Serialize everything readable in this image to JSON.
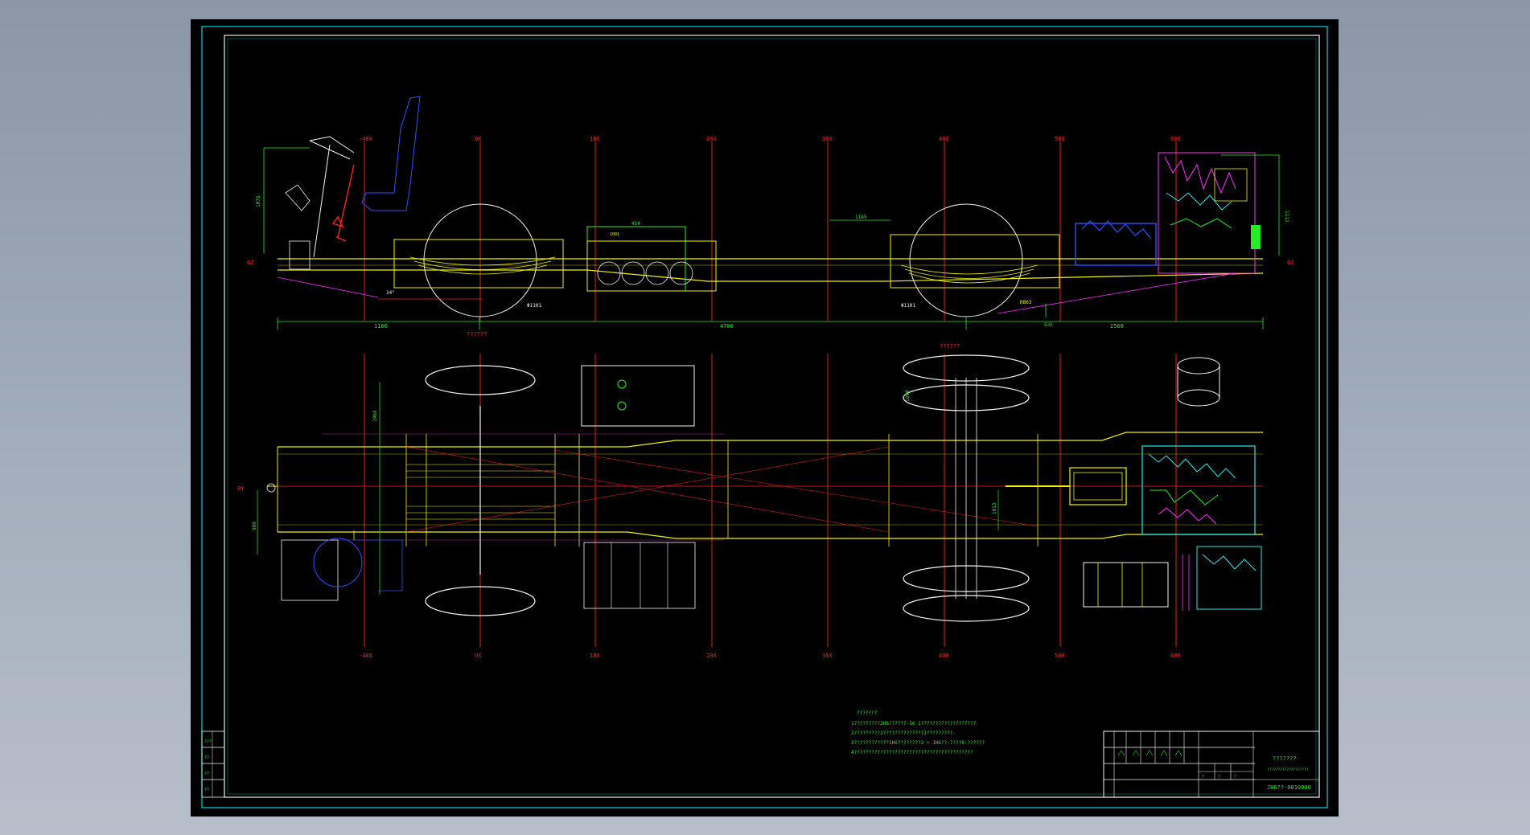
{
  "drawing": {
    "top_station_labels": [
      "-40X",
      "0X",
      "10X",
      "20X",
      "30X",
      "40X",
      "50X",
      "60X"
    ],
    "bottom_station_labels": [
      "-40X",
      "0X",
      "10X",
      "20X",
      "30X",
      "40X",
      "50X",
      "60X"
    ],
    "side_view": {
      "left_datum": "0Z",
      "right_datum": "0Z",
      "dim_overall": "??????",
      "dim_front": "1160",
      "dim_wheelbase": "4700",
      "dim_rear": "2560",
      "dim_small": "535",
      "dim_seat_height": "1075",
      "dim_engine_height": "1112",
      "dim_tank": "414",
      "dim_tank_inner": "1001",
      "dim_offset": "1185",
      "dim_angle": "14°",
      "dim_tire_front": "Φ1101",
      "dim_tire_rear": "Φ1101",
      "dim_radius": "R863"
    },
    "plan_view": {
      "left_datum": "0Y",
      "center_label": "??????",
      "dim_track": "980",
      "dim_width": "1013",
      "dim_front_track": "1968",
      "dim_rear_track": "1800"
    },
    "notes": {
      "heading": "???????",
      "lines": [
        "1?????????JH6??????-16  1???????????????????",
        "2?????????2??????????????2?????????-",
        "3????????????JH6????????2 + JH6??-????0-??????",
        "4?????????????????????????????????????????"
      ]
    },
    "title_block": {
      "project_title": "???????",
      "subtitle": "???????????????????",
      "drawing_number": "JH6??-0010000",
      "weight_label": "?",
      "scale_label": "?",
      "sheet_label": "?"
    },
    "revision_block": {
      "labels": [
        "???",
        "??",
        "??",
        "??"
      ]
    }
  },
  "colors": {
    "background": "#000000",
    "frame": "#00d7d7",
    "yellow": "#f2f200",
    "red": "#ff2020",
    "green": "#22ee22",
    "magenta": "#ff30ff",
    "blue": "#3050ff",
    "white": "#f4f4f4",
    "cyan": "#28e8e8"
  }
}
